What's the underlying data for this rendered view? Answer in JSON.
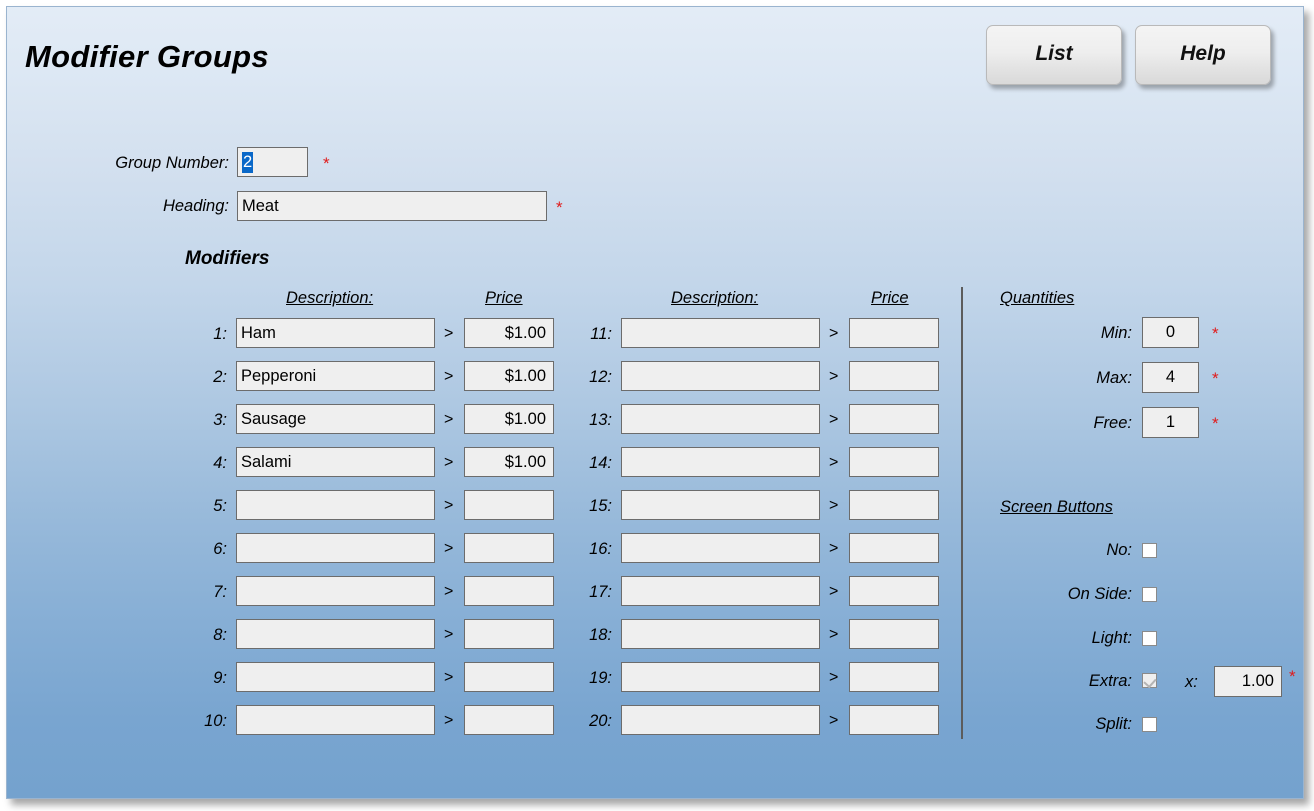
{
  "window": {
    "title": "Modifier Groups"
  },
  "toolbar": {
    "list_label": "List",
    "help_label": "Help"
  },
  "form": {
    "group_number_label": "Group Number:",
    "group_number_value": "2",
    "group_number_required": "*",
    "heading_label": "Heading:",
    "heading_value": "Meat",
    "heading_required": "*"
  },
  "modifiers": {
    "section_title": "Modifiers",
    "headers": {
      "description_left": "Description:",
      "price_left": "Price",
      "description_right": "Description:",
      "price_right": "Price"
    },
    "separator": ">",
    "left_rows": [
      {
        "num": "1:",
        "description": "Ham",
        "price": "$1.00"
      },
      {
        "num": "2:",
        "description": "Pepperoni",
        "price": "$1.00"
      },
      {
        "num": "3:",
        "description": "Sausage",
        "price": "$1.00"
      },
      {
        "num": "4:",
        "description": "Salami",
        "price": "$1.00"
      },
      {
        "num": "5:",
        "description": "",
        "price": ""
      },
      {
        "num": "6:",
        "description": "",
        "price": ""
      },
      {
        "num": "7:",
        "description": "",
        "price": ""
      },
      {
        "num": "8:",
        "description": "",
        "price": ""
      },
      {
        "num": "9:",
        "description": "",
        "price": ""
      },
      {
        "num": "10:",
        "description": "",
        "price": ""
      }
    ],
    "right_rows": [
      {
        "num": "11:",
        "description": "",
        "price": ""
      },
      {
        "num": "12:",
        "description": "",
        "price": ""
      },
      {
        "num": "13:",
        "description": "",
        "price": ""
      },
      {
        "num": "14:",
        "description": "",
        "price": ""
      },
      {
        "num": "15:",
        "description": "",
        "price": ""
      },
      {
        "num": "16:",
        "description": "",
        "price": ""
      },
      {
        "num": "17:",
        "description": "",
        "price": ""
      },
      {
        "num": "18:",
        "description": "",
        "price": ""
      },
      {
        "num": "19:",
        "description": "",
        "price": ""
      },
      {
        "num": "20:",
        "description": "",
        "price": ""
      }
    ]
  },
  "quantities": {
    "section_title": "Quantities",
    "min_label": "Min:",
    "min_value": "0",
    "min_required": "*",
    "max_label": "Max:",
    "max_value": "4",
    "max_required": "*",
    "free_label": "Free:",
    "free_value": "1",
    "free_required": "*"
  },
  "screen_buttons": {
    "section_title": "Screen Buttons",
    "no_label": "No:",
    "no_checked": false,
    "on_side_label": "On Side:",
    "on_side_checked": false,
    "light_label": "Light:",
    "light_checked": false,
    "extra_label": "Extra:",
    "extra_checked": true,
    "extra_multiplier_label": "x:",
    "extra_multiplier_value": "1.00",
    "extra_required": "*",
    "split_label": "Split:",
    "split_checked": false
  },
  "colors": {
    "background_top": "#e3ecf6",
    "background_bottom": "#74a2ce",
    "field_background": "#efefef",
    "field_border": "#6c6c6c",
    "required_asterisk": "#e01b1b",
    "selection": "#0a68c8"
  }
}
